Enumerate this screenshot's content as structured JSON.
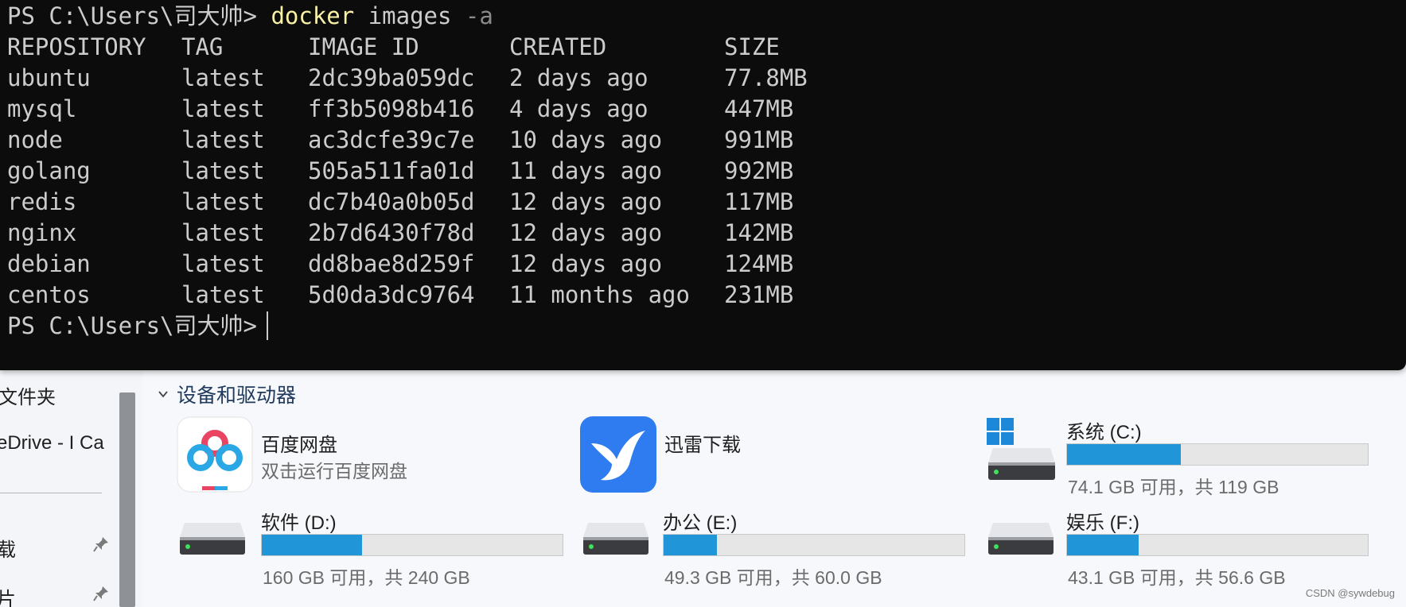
{
  "terminal": {
    "prompt": "PS C:\\Users\\司大帅>",
    "command": "docker",
    "args": "images",
    "flag": "-a",
    "headers": [
      "REPOSITORY",
      "TAG",
      "IMAGE ID",
      "CREATED",
      "SIZE"
    ],
    "rows": [
      [
        "ubuntu",
        "latest",
        "2dc39ba059dc",
        "2 days ago",
        "77.8MB"
      ],
      [
        "mysql",
        "latest",
        "ff3b5098b416",
        "4 days ago",
        "447MB"
      ],
      [
        "node",
        "latest",
        "ac3dcfe39c7e",
        "10 days ago",
        "991MB"
      ],
      [
        "golang",
        "latest",
        "505a511fa01d",
        "11 days ago",
        "992MB"
      ],
      [
        "redis",
        "latest",
        "dc7b40a0b05d",
        "12 days ago",
        "117MB"
      ],
      [
        "nginx",
        "latest",
        "2b7d6430f78d",
        "12 days ago",
        "142MB"
      ],
      [
        "debian",
        "latest",
        "dd8bae8d259f",
        "12 days ago",
        "124MB"
      ],
      [
        "centos",
        "latest",
        "5d0da3dc9764",
        "11 months ago",
        "231MB"
      ]
    ],
    "end_prompt": "PS C:\\Users\\司大帅>"
  },
  "nav": {
    "items": [
      "文件夹",
      "eDrive - I Ca",
      "载",
      "片"
    ]
  },
  "section": {
    "title": "设备和驱动器"
  },
  "apps": [
    {
      "name": "百度网盘",
      "subtitle": "双击运行百度网盘"
    },
    {
      "name": "迅雷下载"
    }
  ],
  "drives": {
    "c": {
      "name": "系统 (C:)",
      "info": "74.1 GB 可用，共 119 GB",
      "used_fraction": 0.377
    },
    "d": {
      "name": "软件 (D:)",
      "info": "160 GB 可用，共 240 GB",
      "used_fraction": 0.333
    },
    "e": {
      "name": "办公 (E:)",
      "info": "49.3 GB 可用，共 60.0 GB",
      "used_fraction": 0.178
    },
    "f": {
      "name": "娱乐 (F:)",
      "info": "43.1 GB 可用，共 56.6 GB",
      "used_fraction": 0.239
    }
  },
  "colors": {
    "bar_fill": "#2096d8",
    "terminal_bg": "#0c0c0c",
    "command": "#f9f1a5"
  },
  "watermark": "CSDN @sywdebug"
}
